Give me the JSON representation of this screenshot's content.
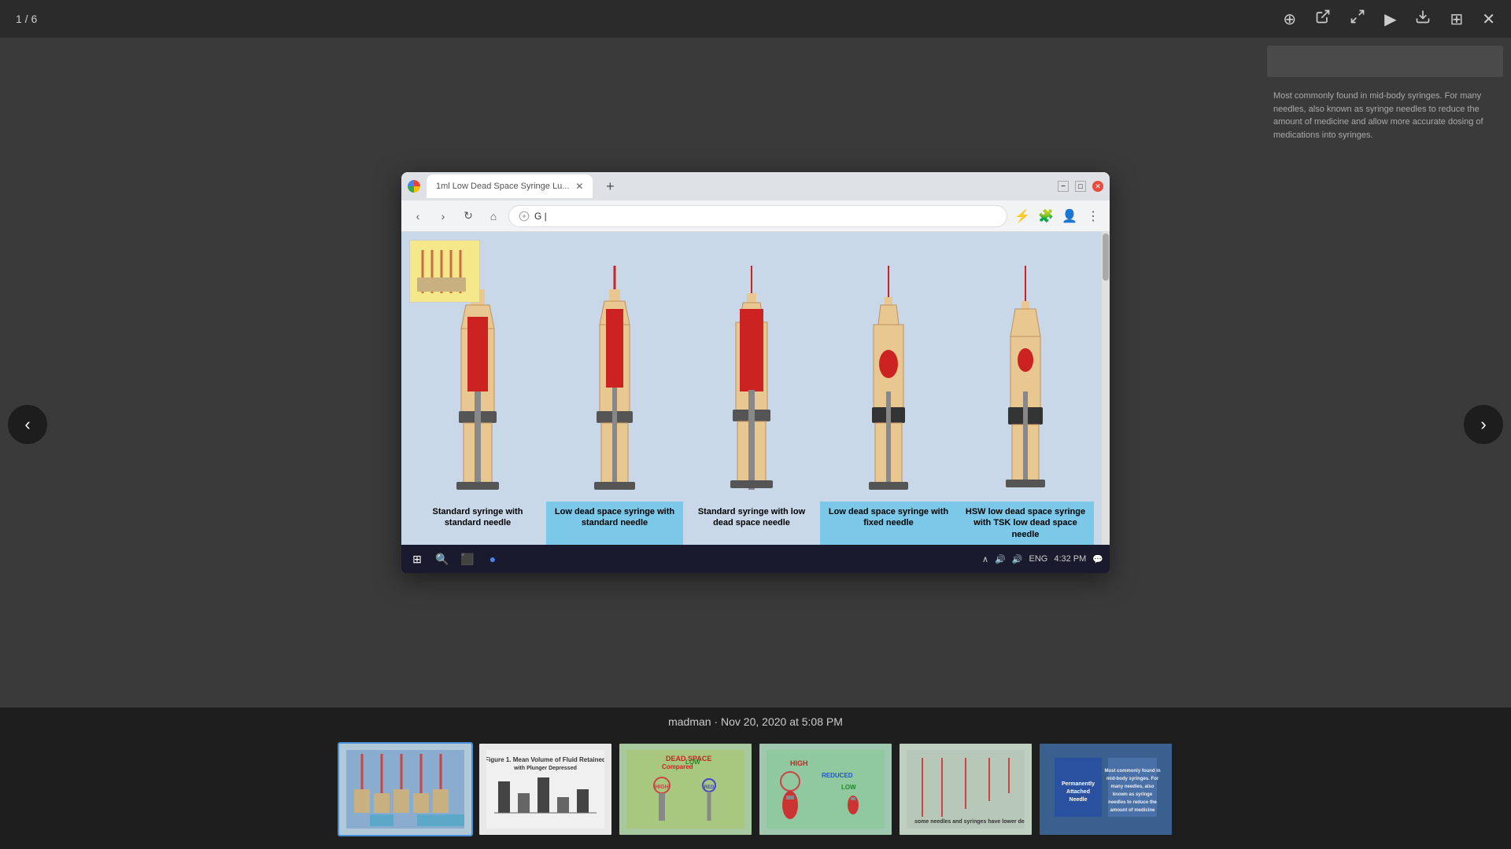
{
  "toolbar": {
    "slide_counter": "1 / 6",
    "icons": [
      "zoom-in",
      "open-external",
      "fullscreen",
      "play",
      "download",
      "grid",
      "close"
    ]
  },
  "browser": {
    "tab_title": "1ml Low Dead Space Syringe Lu...",
    "address": "G |",
    "titlebar_window_buttons": [
      "minimize",
      "maximize",
      "close"
    ],
    "tab_new_label": "+",
    "nav_back": "←",
    "nav_forward": "→",
    "nav_refresh": "↻",
    "nav_home": "⌂"
  },
  "syringes": [
    {
      "id": 1,
      "label": "Standard syringe with standard needle",
      "color": "standard",
      "bg": "#c8d8e8"
    },
    {
      "id": 2,
      "label": "Low dead space syringe with standard needle",
      "color": "highlighted",
      "bg": "#7bc8e8"
    },
    {
      "id": 3,
      "label": "Standard syringe with low dead space needle",
      "color": "standard",
      "bg": "#c8d8e8"
    },
    {
      "id": 4,
      "label": "Low dead space syringe with fixed needle",
      "color": "highlighted",
      "bg": "#7bc8e8"
    },
    {
      "id": 5,
      "label": "HSW low dead space syringe with TSK low dead space needle",
      "color": "highlighted",
      "bg": "#7bc8e8"
    }
  ],
  "meta": {
    "author": "madman",
    "date": "Nov 20, 2020 at 5:08 PM"
  },
  "thumbnails": [
    {
      "id": 1,
      "label": "Syringe comparison",
      "active": true
    },
    {
      "id": 2,
      "label": "Mean volume retained",
      "active": false
    },
    {
      "id": 3,
      "label": "HIGH REDUCED LOW",
      "active": false
    },
    {
      "id": 4,
      "label": "HIGH REDUCED",
      "active": false
    },
    {
      "id": 5,
      "label": "Needles diagram",
      "active": false
    },
    {
      "id": 6,
      "label": "Permanently Attached Needle",
      "active": false
    }
  ],
  "taskbar": {
    "time": "4:32 PM",
    "language": "ENG",
    "icons": [
      "windows",
      "search",
      "task-view",
      "chrome"
    ]
  },
  "nav": {
    "prev_label": "‹",
    "next_label": "›"
  },
  "right_panel": {
    "button_text": "...",
    "description_text": "Most commonly found in mid-body syringes. For many needles, also known as syringe needles to reduce the amount of medicine and allow more accurate dosing of medications into syringes."
  },
  "bottom_text": {
    "reduced": "high REDUCED"
  }
}
